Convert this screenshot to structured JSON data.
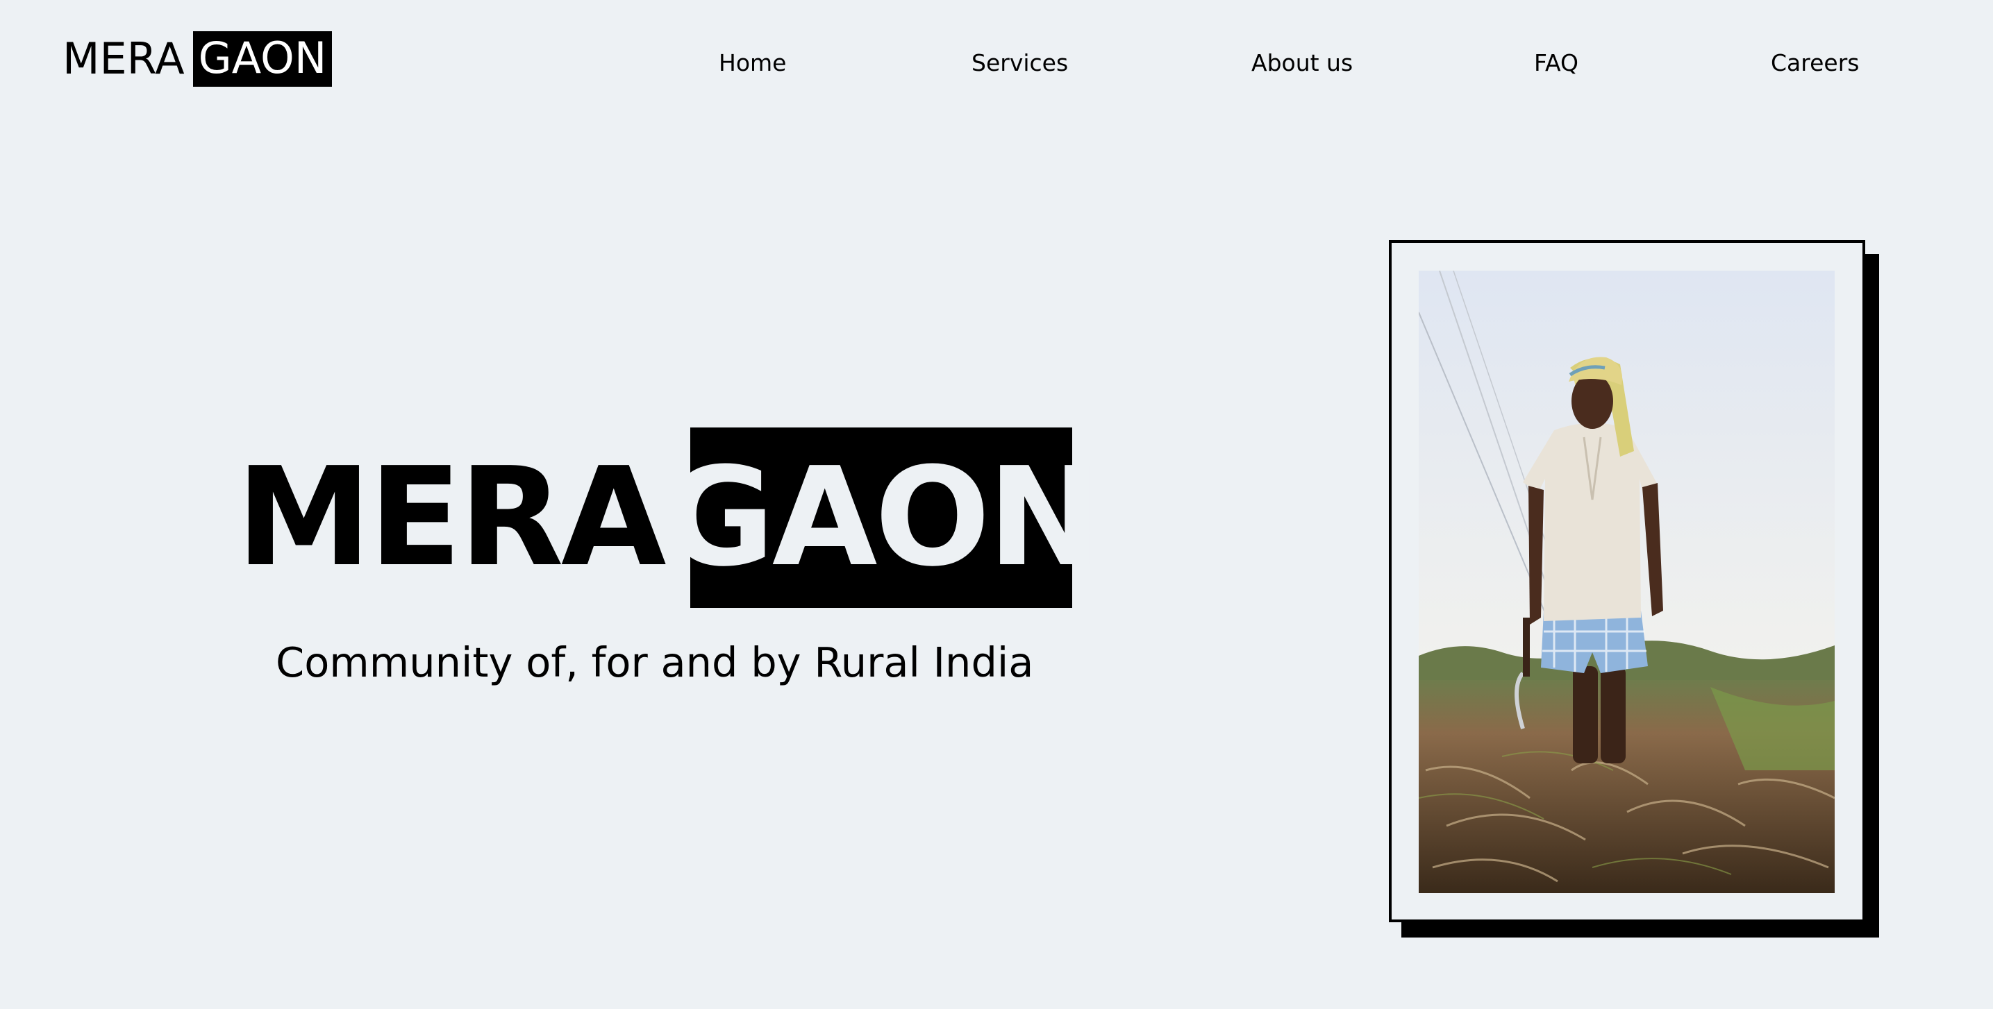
{
  "header": {
    "logo": {
      "word1": "MERA",
      "word2": "GAON"
    },
    "nav": [
      {
        "label": "Home"
      },
      {
        "label": "Services"
      },
      {
        "label": "About us"
      },
      {
        "label": "FAQ"
      },
      {
        "label": "Careers"
      }
    ]
  },
  "hero": {
    "title_word1": "MERA",
    "title_word2": "GAON",
    "tagline": "Community of, for and by Rural India"
  },
  "colors": {
    "background": "#edf1f4",
    "accent": "#000000",
    "inverse_text": "#ffffff"
  }
}
